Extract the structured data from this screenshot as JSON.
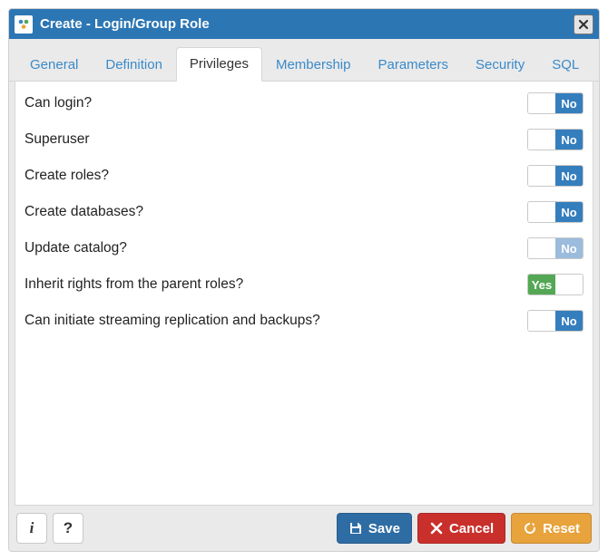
{
  "title": "Create - Login/Group Role",
  "tabs": [
    {
      "label": "General"
    },
    {
      "label": "Definition"
    },
    {
      "label": "Privileges"
    },
    {
      "label": "Membership"
    },
    {
      "label": "Parameters"
    },
    {
      "label": "Security"
    },
    {
      "label": "SQL"
    }
  ],
  "active_tab": 2,
  "toggle_labels": {
    "yes": "Yes",
    "no": "No"
  },
  "privileges": [
    {
      "label": "Can login?",
      "value": false,
      "disabled": false
    },
    {
      "label": "Superuser",
      "value": false,
      "disabled": false
    },
    {
      "label": "Create roles?",
      "value": false,
      "disabled": false
    },
    {
      "label": "Create databases?",
      "value": false,
      "disabled": false
    },
    {
      "label": "Update catalog?",
      "value": false,
      "disabled": true
    },
    {
      "label": "Inherit rights from the parent roles?",
      "value": true,
      "disabled": false
    },
    {
      "label": "Can initiate streaming replication and backups?",
      "value": false,
      "disabled": false
    }
  ],
  "footer": {
    "info": "i",
    "help": "?",
    "save": "Save",
    "cancel": "Cancel",
    "reset": "Reset"
  }
}
